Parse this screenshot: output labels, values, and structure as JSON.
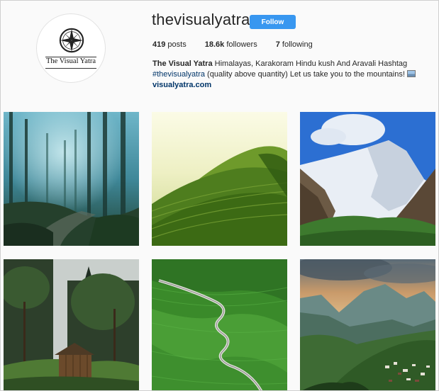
{
  "profile": {
    "avatar_text": "The Visual Yatra",
    "username": "thevisualyatra",
    "follow_label": "Follow",
    "stats": {
      "posts_count": "419",
      "posts_label": "posts",
      "followers_count": "18.6k",
      "followers_label": "followers",
      "following_count": "7",
      "following_label": "following"
    },
    "bio": {
      "name": "The Visual Yatra",
      "text1": " Himalayas, Karakoram Hindu kush And Aravali Hashtag",
      "hashtag": "#thevisualyatra",
      "text2": " (quality above quantity) Let us take you to the mountains! ",
      "link": "visualyatra.com"
    }
  },
  "grid": {
    "tiles": [
      {
        "subject": "misty pine forest"
      },
      {
        "subject": "tea garden hills"
      },
      {
        "subject": "snow peak blue sky"
      },
      {
        "subject": "wooden cabin in forest"
      },
      {
        "subject": "winding road green hills"
      },
      {
        "subject": "mountain village sunset"
      }
    ]
  },
  "colors": {
    "follow_bg": "#3897f0",
    "link": "#003569"
  }
}
